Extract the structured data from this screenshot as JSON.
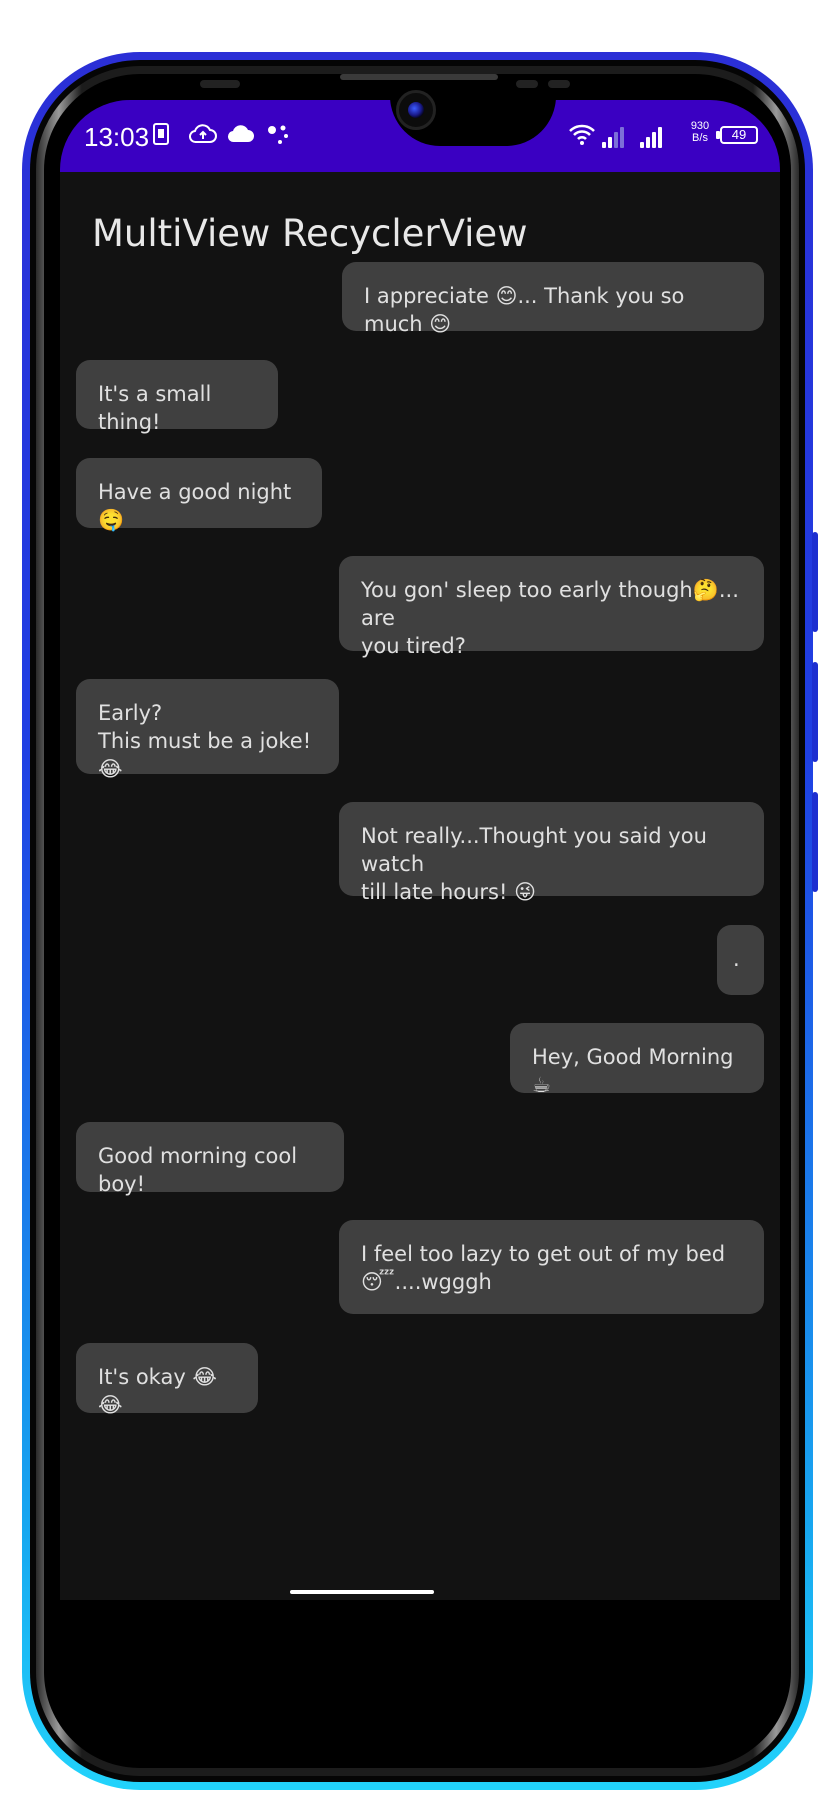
{
  "status_bar": {
    "time": "13:03",
    "net_speed_value": "930",
    "net_speed_unit": "B/s",
    "battery": "49",
    "icons": [
      "sim-card-icon",
      "cloud-upload-icon",
      "cloud-icon",
      "assistant-dots-icon",
      "wifi-icon",
      "signal-icon",
      "signal-icon",
      "battery-icon"
    ]
  },
  "app": {
    "title": "MultiView RecyclerView"
  },
  "messages": [
    {
      "side": "sent",
      "text": "I appreciate 😊... Thank you so much 😊"
    },
    {
      "side": "recv",
      "text": "It's a small thing!"
    },
    {
      "side": "recv",
      "text": "Have a good night 🤤"
    },
    {
      "side": "sent",
      "text": "You gon' sleep too early though🤔... are\nyou tired?"
    },
    {
      "side": "recv",
      "text": "Early?\nThis must be a joke! 😂"
    },
    {
      "side": "sent",
      "text": "Not really...Thought you said you watch\ntill late hours! 😜"
    },
    {
      "side": "sent",
      "text": "."
    },
    {
      "side": "sent",
      "text": "Hey, Good Morning ☕"
    },
    {
      "side": "recv",
      "text": "Good morning cool boy!"
    },
    {
      "side": "sent",
      "text": "I feel too lazy to get out of my bed\n😴....wgggh"
    },
    {
      "side": "recv",
      "text": "It's okay 😂 😂"
    }
  ],
  "colors": {
    "status_bar": "#3a00c2",
    "background": "#121212",
    "bubble": "#404040",
    "text": "#e0e0e0"
  }
}
